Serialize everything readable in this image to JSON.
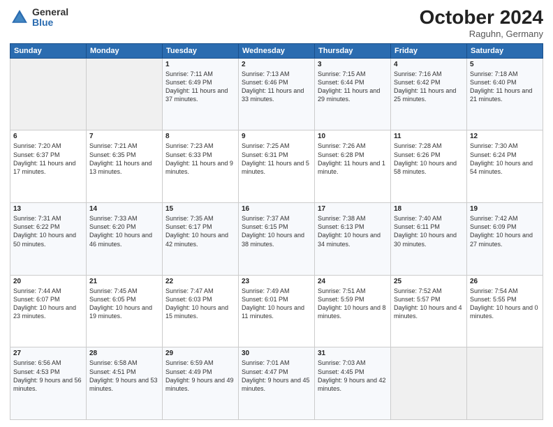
{
  "logo": {
    "general": "General",
    "blue": "Blue"
  },
  "header": {
    "month": "October 2024",
    "location": "Raguhn, Germany"
  },
  "weekdays": [
    "Sunday",
    "Monday",
    "Tuesday",
    "Wednesday",
    "Thursday",
    "Friday",
    "Saturday"
  ],
  "weeks": [
    [
      {
        "day": "",
        "sunrise": "",
        "sunset": "",
        "daylight": ""
      },
      {
        "day": "",
        "sunrise": "",
        "sunset": "",
        "daylight": ""
      },
      {
        "day": "1",
        "sunrise": "Sunrise: 7:11 AM",
        "sunset": "Sunset: 6:49 PM",
        "daylight": "Daylight: 11 hours and 37 minutes."
      },
      {
        "day": "2",
        "sunrise": "Sunrise: 7:13 AM",
        "sunset": "Sunset: 6:46 PM",
        "daylight": "Daylight: 11 hours and 33 minutes."
      },
      {
        "day": "3",
        "sunrise": "Sunrise: 7:15 AM",
        "sunset": "Sunset: 6:44 PM",
        "daylight": "Daylight: 11 hours and 29 minutes."
      },
      {
        "day": "4",
        "sunrise": "Sunrise: 7:16 AM",
        "sunset": "Sunset: 6:42 PM",
        "daylight": "Daylight: 11 hours and 25 minutes."
      },
      {
        "day": "5",
        "sunrise": "Sunrise: 7:18 AM",
        "sunset": "Sunset: 6:40 PM",
        "daylight": "Daylight: 11 hours and 21 minutes."
      }
    ],
    [
      {
        "day": "6",
        "sunrise": "Sunrise: 7:20 AM",
        "sunset": "Sunset: 6:37 PM",
        "daylight": "Daylight: 11 hours and 17 minutes."
      },
      {
        "day": "7",
        "sunrise": "Sunrise: 7:21 AM",
        "sunset": "Sunset: 6:35 PM",
        "daylight": "Daylight: 11 hours and 13 minutes."
      },
      {
        "day": "8",
        "sunrise": "Sunrise: 7:23 AM",
        "sunset": "Sunset: 6:33 PM",
        "daylight": "Daylight: 11 hours and 9 minutes."
      },
      {
        "day": "9",
        "sunrise": "Sunrise: 7:25 AM",
        "sunset": "Sunset: 6:31 PM",
        "daylight": "Daylight: 11 hours and 5 minutes."
      },
      {
        "day": "10",
        "sunrise": "Sunrise: 7:26 AM",
        "sunset": "Sunset: 6:28 PM",
        "daylight": "Daylight: 11 hours and 1 minute."
      },
      {
        "day": "11",
        "sunrise": "Sunrise: 7:28 AM",
        "sunset": "Sunset: 6:26 PM",
        "daylight": "Daylight: 10 hours and 58 minutes."
      },
      {
        "day": "12",
        "sunrise": "Sunrise: 7:30 AM",
        "sunset": "Sunset: 6:24 PM",
        "daylight": "Daylight: 10 hours and 54 minutes."
      }
    ],
    [
      {
        "day": "13",
        "sunrise": "Sunrise: 7:31 AM",
        "sunset": "Sunset: 6:22 PM",
        "daylight": "Daylight: 10 hours and 50 minutes."
      },
      {
        "day": "14",
        "sunrise": "Sunrise: 7:33 AM",
        "sunset": "Sunset: 6:20 PM",
        "daylight": "Daylight: 10 hours and 46 minutes."
      },
      {
        "day": "15",
        "sunrise": "Sunrise: 7:35 AM",
        "sunset": "Sunset: 6:17 PM",
        "daylight": "Daylight: 10 hours and 42 minutes."
      },
      {
        "day": "16",
        "sunrise": "Sunrise: 7:37 AM",
        "sunset": "Sunset: 6:15 PM",
        "daylight": "Daylight: 10 hours and 38 minutes."
      },
      {
        "day": "17",
        "sunrise": "Sunrise: 7:38 AM",
        "sunset": "Sunset: 6:13 PM",
        "daylight": "Daylight: 10 hours and 34 minutes."
      },
      {
        "day": "18",
        "sunrise": "Sunrise: 7:40 AM",
        "sunset": "Sunset: 6:11 PM",
        "daylight": "Daylight: 10 hours and 30 minutes."
      },
      {
        "day": "19",
        "sunrise": "Sunrise: 7:42 AM",
        "sunset": "Sunset: 6:09 PM",
        "daylight": "Daylight: 10 hours and 27 minutes."
      }
    ],
    [
      {
        "day": "20",
        "sunrise": "Sunrise: 7:44 AM",
        "sunset": "Sunset: 6:07 PM",
        "daylight": "Daylight: 10 hours and 23 minutes."
      },
      {
        "day": "21",
        "sunrise": "Sunrise: 7:45 AM",
        "sunset": "Sunset: 6:05 PM",
        "daylight": "Daylight: 10 hours and 19 minutes."
      },
      {
        "day": "22",
        "sunrise": "Sunrise: 7:47 AM",
        "sunset": "Sunset: 6:03 PM",
        "daylight": "Daylight: 10 hours and 15 minutes."
      },
      {
        "day": "23",
        "sunrise": "Sunrise: 7:49 AM",
        "sunset": "Sunset: 6:01 PM",
        "daylight": "Daylight: 10 hours and 11 minutes."
      },
      {
        "day": "24",
        "sunrise": "Sunrise: 7:51 AM",
        "sunset": "Sunset: 5:59 PM",
        "daylight": "Daylight: 10 hours and 8 minutes."
      },
      {
        "day": "25",
        "sunrise": "Sunrise: 7:52 AM",
        "sunset": "Sunset: 5:57 PM",
        "daylight": "Daylight: 10 hours and 4 minutes."
      },
      {
        "day": "26",
        "sunrise": "Sunrise: 7:54 AM",
        "sunset": "Sunset: 5:55 PM",
        "daylight": "Daylight: 10 hours and 0 minutes."
      }
    ],
    [
      {
        "day": "27",
        "sunrise": "Sunrise: 6:56 AM",
        "sunset": "Sunset: 4:53 PM",
        "daylight": "Daylight: 9 hours and 56 minutes."
      },
      {
        "day": "28",
        "sunrise": "Sunrise: 6:58 AM",
        "sunset": "Sunset: 4:51 PM",
        "daylight": "Daylight: 9 hours and 53 minutes."
      },
      {
        "day": "29",
        "sunrise": "Sunrise: 6:59 AM",
        "sunset": "Sunset: 4:49 PM",
        "daylight": "Daylight: 9 hours and 49 minutes."
      },
      {
        "day": "30",
        "sunrise": "Sunrise: 7:01 AM",
        "sunset": "Sunset: 4:47 PM",
        "daylight": "Daylight: 9 hours and 45 minutes."
      },
      {
        "day": "31",
        "sunrise": "Sunrise: 7:03 AM",
        "sunset": "Sunset: 4:45 PM",
        "daylight": "Daylight: 9 hours and 42 minutes."
      },
      {
        "day": "",
        "sunrise": "",
        "sunset": "",
        "daylight": ""
      },
      {
        "day": "",
        "sunrise": "",
        "sunset": "",
        "daylight": ""
      }
    ]
  ]
}
